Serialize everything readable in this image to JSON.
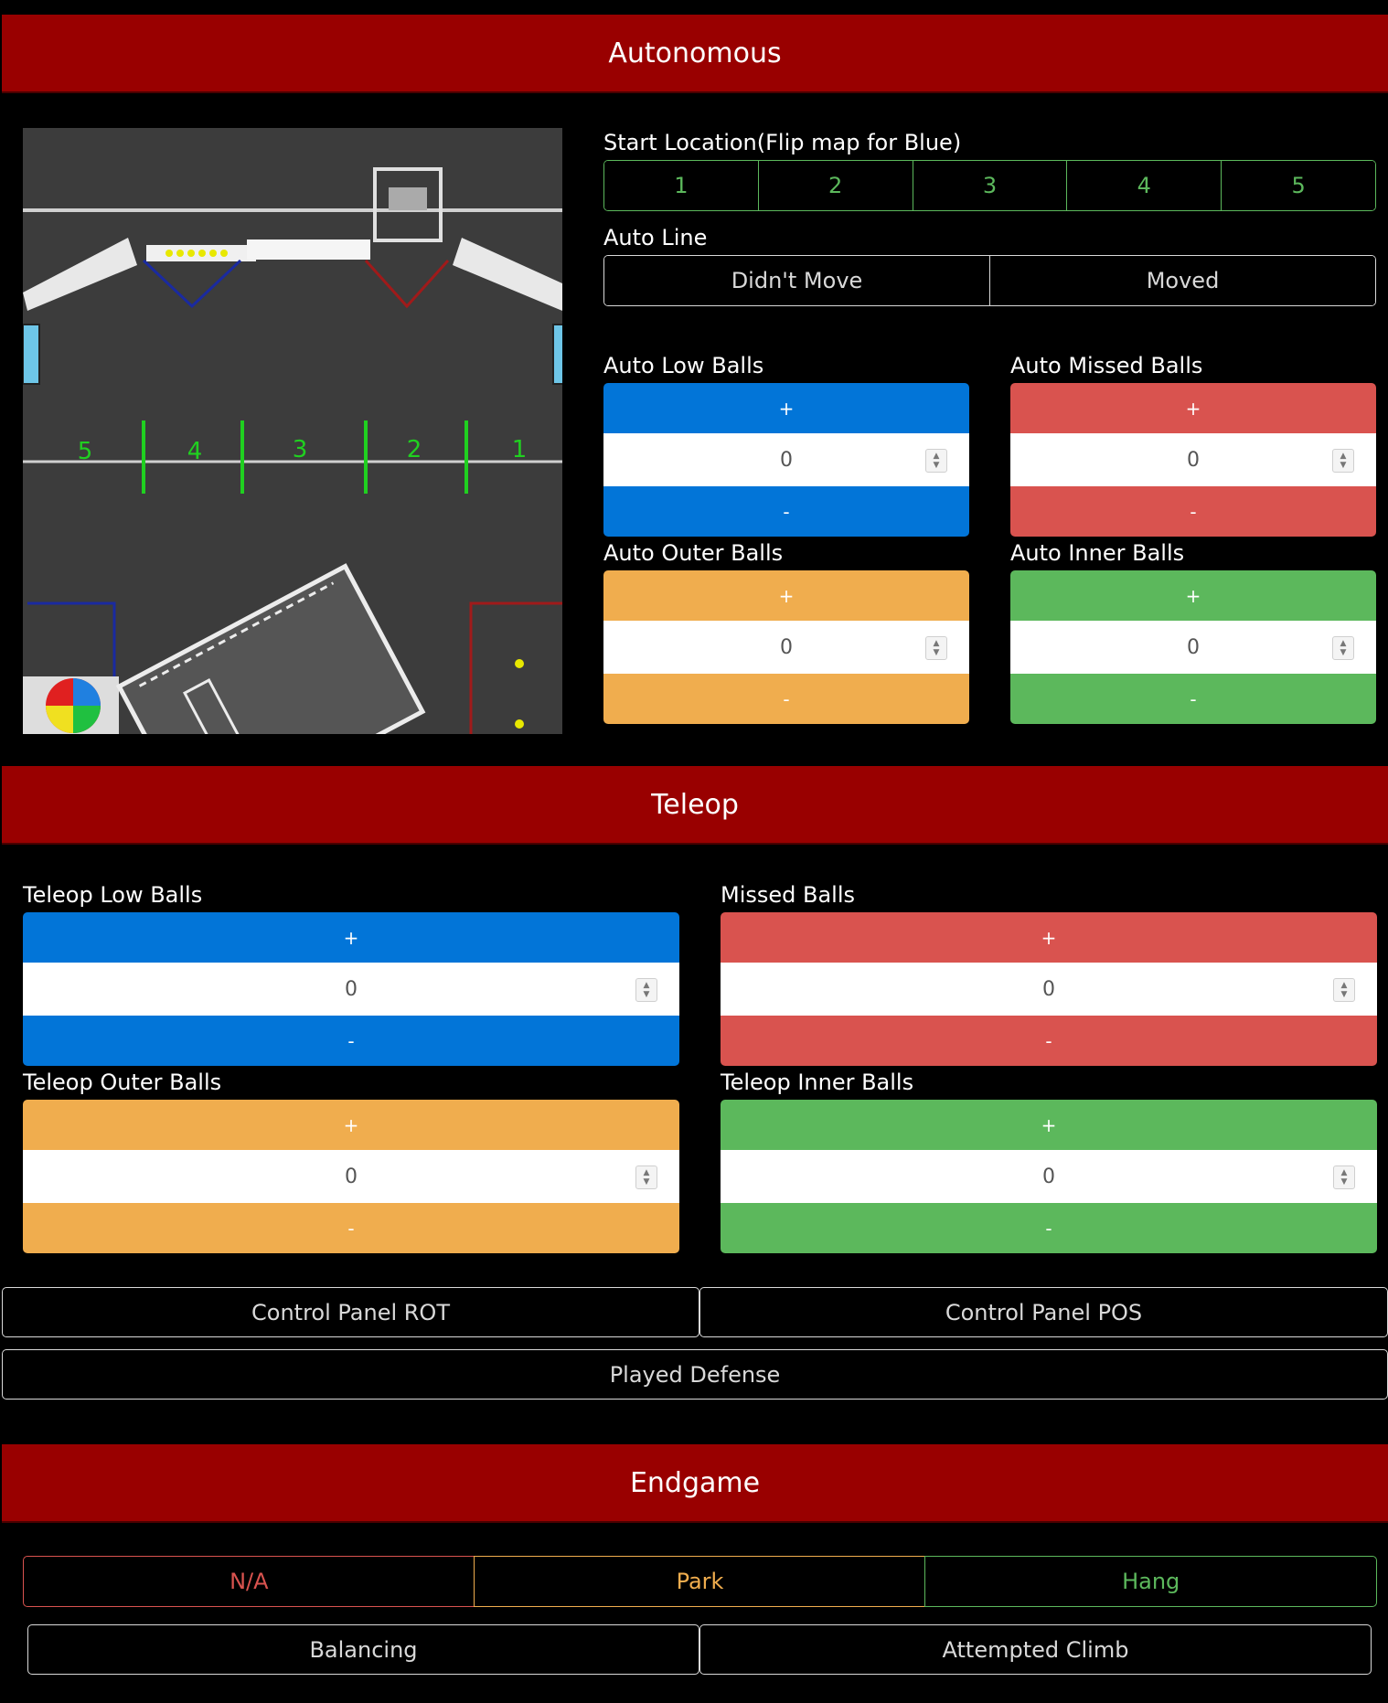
{
  "autonomous": {
    "header": "Autonomous",
    "start_location": {
      "label": "Start Location(Flip map for Blue)",
      "options": [
        "1",
        "2",
        "3",
        "4",
        "5"
      ]
    },
    "auto_line": {
      "label": "Auto Line",
      "options": [
        "Didn't Move",
        "Moved"
      ]
    },
    "field_map": {
      "positions": [
        "5",
        "4",
        "3",
        "2",
        "1"
      ]
    },
    "counters": {
      "low": {
        "label": "Auto Low Balls",
        "plus": "+",
        "minus": "-",
        "value": "0",
        "color": "#0275d8"
      },
      "missed": {
        "label": "Auto Missed Balls",
        "plus": "+",
        "minus": "-",
        "value": "0",
        "color": "#d9534f"
      },
      "outer": {
        "label": "Auto Outer Balls",
        "plus": "+",
        "minus": "-",
        "value": "0",
        "color": "#f0ad4e"
      },
      "inner": {
        "label": "Auto Inner Balls",
        "plus": "+",
        "minus": "-",
        "value": "0",
        "color": "#5cb85c"
      }
    }
  },
  "teleop": {
    "header": "Teleop",
    "counters": {
      "low": {
        "label": "Teleop Low Balls",
        "plus": "+",
        "minus": "-",
        "value": "0",
        "color": "#0275d8"
      },
      "missed": {
        "label": "Missed Balls",
        "plus": "+",
        "minus": "-",
        "value": "0",
        "color": "#d9534f"
      },
      "outer": {
        "label": "Teleop Outer Balls",
        "plus": "+",
        "minus": "-",
        "value": "0",
        "color": "#f0ad4e"
      },
      "inner": {
        "label": "Teleop Inner Balls",
        "plus": "+",
        "minus": "-",
        "value": "0",
        "color": "#5cb85c"
      }
    },
    "control_panel_rot": "Control Panel ROT",
    "control_panel_pos": "Control Panel POS",
    "played_defense": "Played Defense"
  },
  "endgame": {
    "header": "Endgame",
    "options": [
      {
        "label": "N/A",
        "color": "#d9534f"
      },
      {
        "label": "Park",
        "color": "#f0ad4e"
      },
      {
        "label": "Hang",
        "color": "#5cb85c"
      }
    ],
    "balancing": "Balancing",
    "attempted_climb": "Attempted Climb"
  },
  "colors": {
    "header_bg": "#990000",
    "page_bg": "#000000"
  }
}
